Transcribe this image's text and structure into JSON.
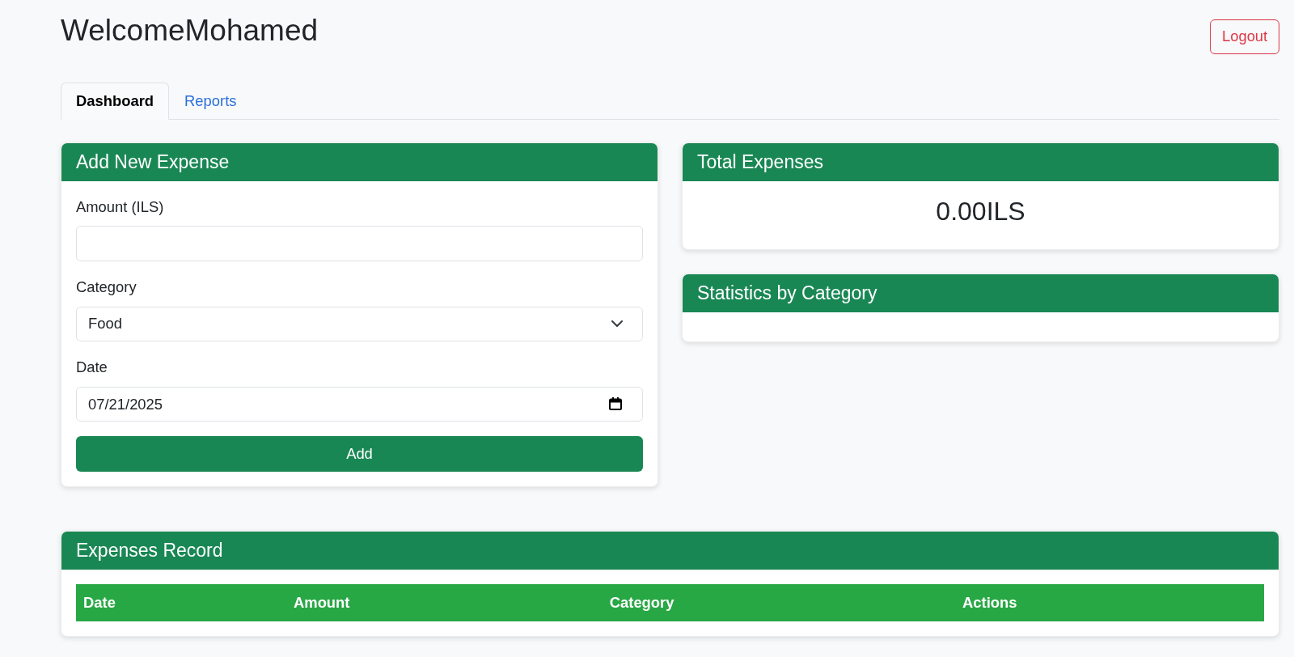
{
  "header": {
    "title": "WelcomeMohamed",
    "logout_button": "Logout"
  },
  "tabs": [
    {
      "label": "Dashboard",
      "selected": true
    },
    {
      "label": "Reports",
      "selected": false
    }
  ],
  "add_expense": {
    "title": "Add New Expense",
    "fields": [
      {
        "kind": "text",
        "label": "Amount (ILS)"
      },
      {
        "kind": "select",
        "label": "Category",
        "value": "Food"
      },
      {
        "kind": "date",
        "label": "Date",
        "value": "07/21/2025"
      }
    ],
    "submit_button": "Add"
  },
  "total_expenses": {
    "title": "Total Expenses",
    "value": "0.00ILS"
  },
  "statistics": {
    "title": "Statistics by Category"
  },
  "expenses_record": {
    "title": "Expenses Record",
    "table": {
      "columns": [
        "Date",
        "Amount",
        "Category",
        "Actions"
      ]
    }
  }
}
